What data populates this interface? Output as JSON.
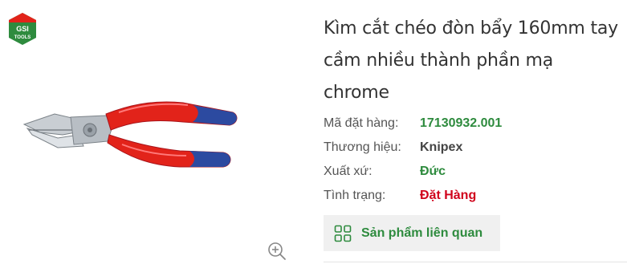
{
  "brand": {
    "logo_top": "GSI",
    "logo_bottom": "TOOLS"
  },
  "icons": {
    "zoom": "zoom-in-icon",
    "related": "grid-icon"
  },
  "product": {
    "title": "Kìm cắt chéo đòn bẩy 160mm tay cầm nhiều thành phần mạ chrome",
    "specs": [
      {
        "label": "Mã đặt hàng:",
        "value": "17130932.001"
      },
      {
        "label": "Thương hiệu:",
        "value": "Knipex"
      },
      {
        "label": "Xuất xứ:",
        "value": "Đức"
      },
      {
        "label": "Tình trạng:",
        "value": "Đặt Hàng"
      }
    ]
  },
  "related_button": {
    "label": "Sản phẩm liên quan"
  },
  "colors": {
    "accent": "#2e8b3e",
    "status": "#d0021b",
    "button_bg": "#f0f0f0"
  }
}
